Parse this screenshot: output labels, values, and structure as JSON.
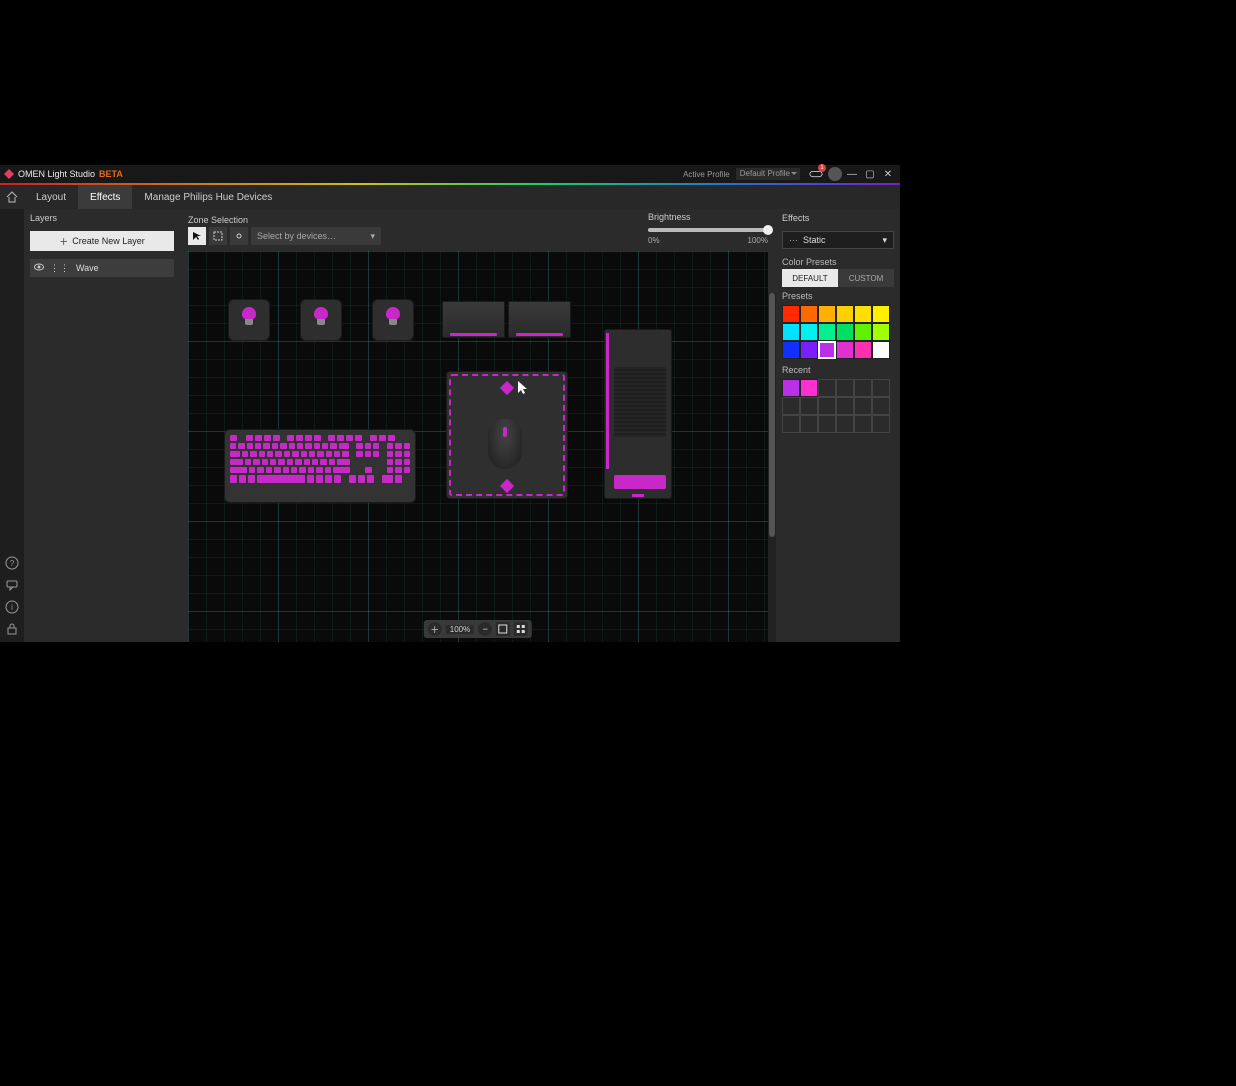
{
  "title": "OMEN Light Studio",
  "beta_label": "BETA",
  "active_profile_label": "Active Profile",
  "profile_selected": "Default Profile",
  "game_badge": "1",
  "tabs": {
    "layout": "Layout",
    "effects": "Effects",
    "hue": "Manage Philips Hue Devices"
  },
  "layers": {
    "header": "Layers",
    "create_btn": "Create New Layer",
    "items": [
      {
        "name": "Wave"
      }
    ]
  },
  "zone": {
    "header": "Zone Selection",
    "device_select_placeholder": "Select by devices…"
  },
  "brightness": {
    "label": "Brightness",
    "min": "0%",
    "max": "100%",
    "value": 100
  },
  "zoom": {
    "value": "100%"
  },
  "effects": {
    "header": "Effects",
    "selected": "Static",
    "color_presets_label": "Color Presets",
    "seg_default": "DEFAULT",
    "seg_custom": "CUSTOM",
    "presets_label": "Presets",
    "recent_label": "Recent",
    "preset_colors": [
      "#ff2a00",
      "#ff6a00",
      "#ffb000",
      "#ffd000",
      "#ffe000",
      "#fff000",
      "#00e0ff",
      "#00f0f0",
      "#00f090",
      "#00e060",
      "#60f000",
      "#a0ff00",
      "#1030ff",
      "#7a20ff",
      "#b930e8",
      "#e030d0",
      "#ff30b0",
      "#ffffff"
    ],
    "preset_selected_index": 14,
    "recent_colors": [
      "#b930e8",
      "#ff30d0"
    ]
  }
}
